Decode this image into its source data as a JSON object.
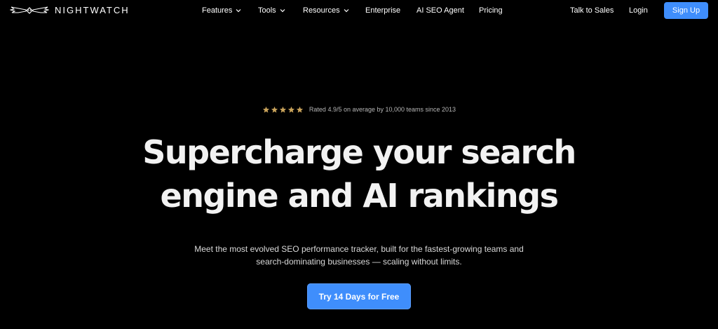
{
  "brand": {
    "name": "NIGHTWATCH",
    "logo_icon": "owl-wings-icon"
  },
  "nav": {
    "features": "Features",
    "tools": "Tools",
    "resources": "Resources",
    "enterprise": "Enterprise",
    "ai_seo_agent": "AI SEO Agent",
    "pricing": "Pricing",
    "talk_to_sales": "Talk to Sales",
    "login": "Login",
    "sign_up": "Sign Up"
  },
  "hero": {
    "rating_stars": 5,
    "rating_text": "Rated 4.9/5 on average by 10,000 teams since 2013",
    "headline_line1": "Supercharge your search",
    "headline_line2": "engine and AI rankings",
    "sub_line1": "Meet the most evolved SEO performance tracker, built for the fastest-growing teams and",
    "sub_line2": "search-dominating businesses — scaling without limits.",
    "cta": "Try 14 Days for Free"
  },
  "colors": {
    "background": "#000000",
    "accent": "#3f8efc",
    "star": "#c9a35a",
    "text": "#ffffff"
  }
}
